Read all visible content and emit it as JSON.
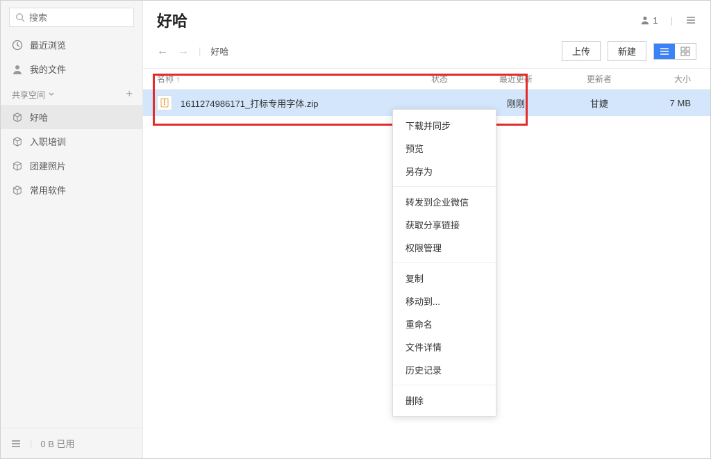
{
  "window": {
    "minimize": "—",
    "maximize": "□",
    "close": "✕"
  },
  "sidebar": {
    "search_placeholder": "搜索",
    "nav": {
      "recent": "最近浏览",
      "myfiles": "我的文件"
    },
    "section": {
      "title": "共享空间",
      "items": [
        "好哈",
        "入职培训",
        "团建照片",
        "常用软件"
      ]
    },
    "footer": {
      "usage": "0 B 已用"
    }
  },
  "header": {
    "title": "好哈",
    "people": "1"
  },
  "toolbar": {
    "breadcrumb": "好哈",
    "upload": "上传",
    "new": "新建"
  },
  "columns": {
    "name": "名称 ↑",
    "status": "状态",
    "updated": "最近更新",
    "updater": "更新者",
    "size": "大小"
  },
  "row": {
    "name": "1611274986171_打标专用字体.zip",
    "status": "",
    "updated": "刚刚",
    "updater": "甘婕",
    "size": "7 MB"
  },
  "menu": {
    "download_sync": "下载并同步",
    "preview": "预览",
    "save_as": "另存为",
    "forward_wecom": "转发到企业微信",
    "get_link": "获取分享链接",
    "permission": "权限管理",
    "copy": "复制",
    "move_to": "移动到...",
    "rename": "重命名",
    "details": "文件详情",
    "history": "历史记录",
    "delete": "删除"
  }
}
